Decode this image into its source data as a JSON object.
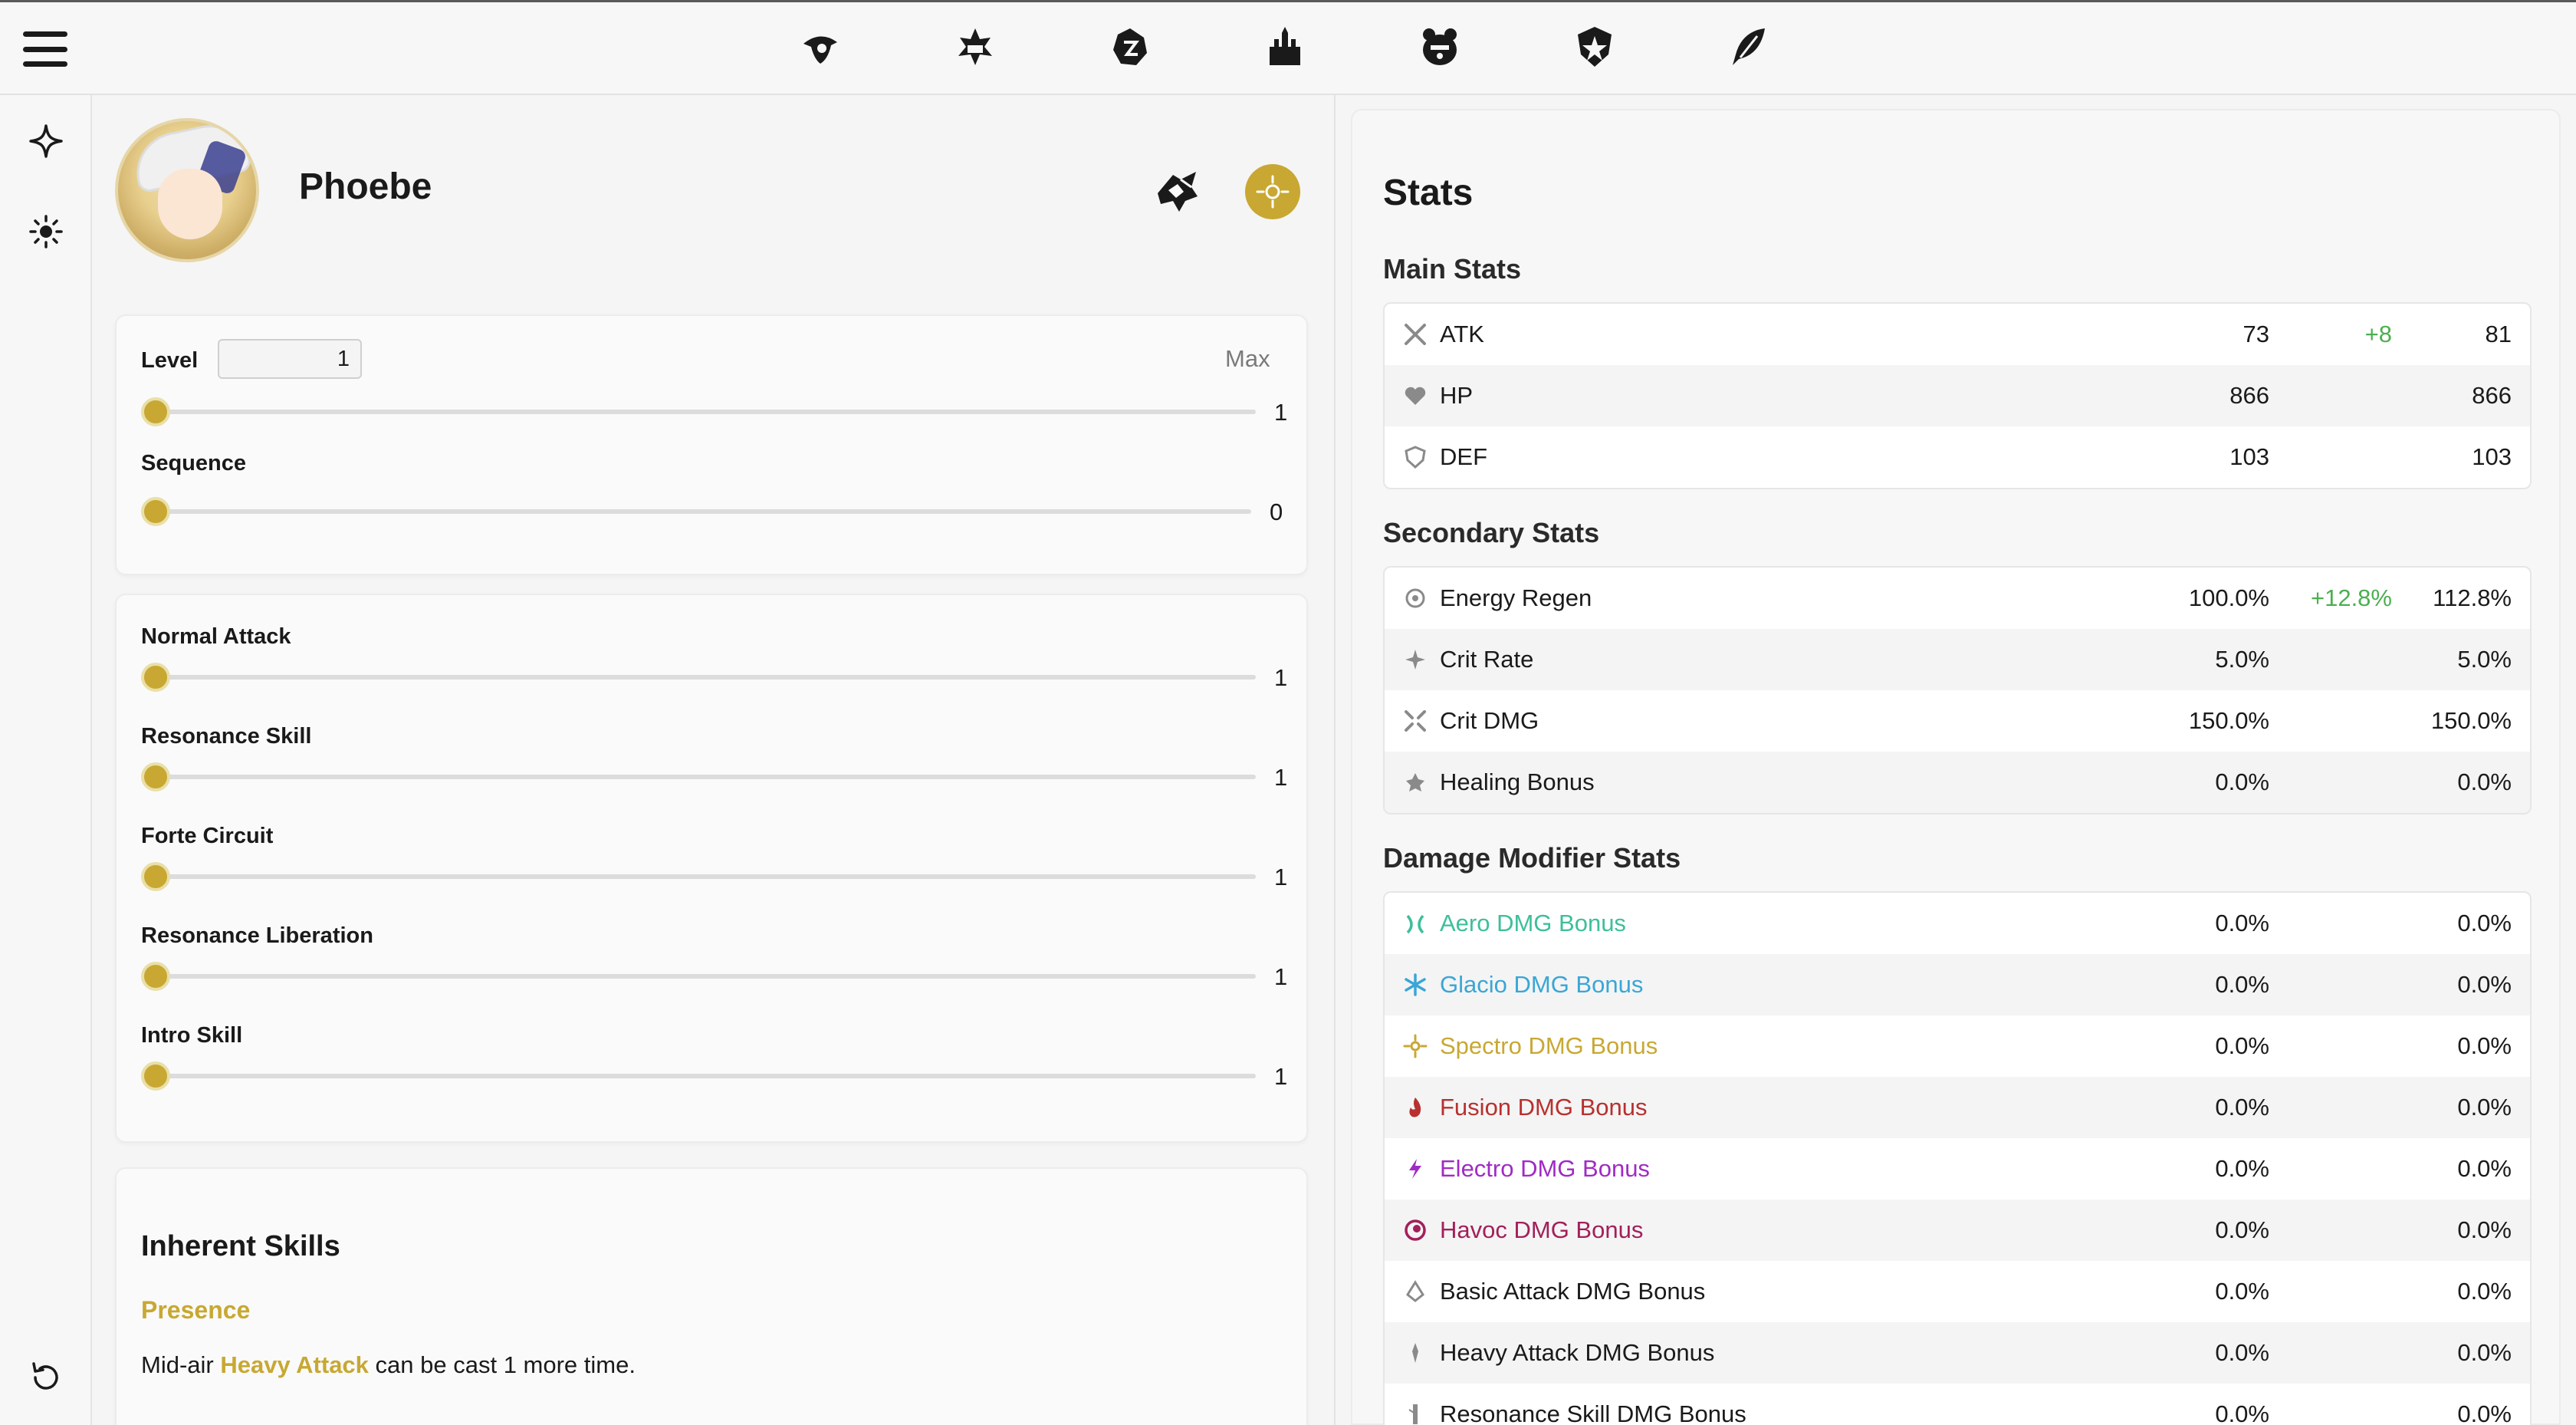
{
  "character": {
    "name": "Phoebe"
  },
  "progression": {
    "level_label": "Level",
    "level_value": "1",
    "max_label": "Max",
    "level_slider_value": "1",
    "sequence_label": "Sequence",
    "sequence_value": "0"
  },
  "skills": [
    {
      "label": "Normal Attack",
      "value": "1"
    },
    {
      "label": "Resonance Skill",
      "value": "1"
    },
    {
      "label": "Forte Circuit",
      "value": "1"
    },
    {
      "label": "Resonance Liberation",
      "value": "1"
    },
    {
      "label": "Intro Skill",
      "value": "1"
    }
  ],
  "inherent": {
    "title": "Inherent Skills",
    "skill_name": "Presence",
    "desc_prefix": "Mid-air ",
    "desc_highlight": "Heavy Attack",
    "desc_suffix": " can be cast 1 more time."
  },
  "stats": {
    "title": "Stats",
    "main_title": "Main Stats",
    "main": [
      {
        "name": "ATK",
        "base": "73",
        "bonus": "+8",
        "total": "81",
        "icon": "atk-icon"
      },
      {
        "name": "HP",
        "base": "866",
        "bonus": "",
        "total": "866",
        "icon": "hp-icon"
      },
      {
        "name": "DEF",
        "base": "103",
        "bonus": "",
        "total": "103",
        "icon": "def-icon"
      }
    ],
    "secondary_title": "Secondary Stats",
    "secondary": [
      {
        "name": "Energy Regen",
        "base": "100.0%",
        "bonus": "+12.8%",
        "total": "112.8%",
        "icon": "energy-regen-icon"
      },
      {
        "name": "Crit Rate",
        "base": "5.0%",
        "bonus": "",
        "total": "5.0%",
        "icon": "crit-rate-icon"
      },
      {
        "name": "Crit DMG",
        "base": "150.0%",
        "bonus": "",
        "total": "150.0%",
        "icon": "crit-dmg-icon"
      },
      {
        "name": "Healing Bonus",
        "base": "0.0%",
        "bonus": "",
        "total": "0.0%",
        "icon": "healing-icon"
      }
    ],
    "damage_title": "Damage Modifier Stats",
    "damage": [
      {
        "name": "Aero DMG Bonus",
        "base": "0.0%",
        "total": "0.0%",
        "color": "#3dbf9a",
        "icon": "aero-icon"
      },
      {
        "name": "Glacio DMG Bonus",
        "base": "0.0%",
        "total": "0.0%",
        "color": "#3aa6d6",
        "icon": "glacio-icon"
      },
      {
        "name": "Spectro DMG Bonus",
        "base": "0.0%",
        "total": "0.0%",
        "color": "#c8a832",
        "icon": "spectro-icon"
      },
      {
        "name": "Fusion DMG Bonus",
        "base": "0.0%",
        "total": "0.0%",
        "color": "#b8302f",
        "icon": "fusion-icon"
      },
      {
        "name": "Electro DMG Bonus",
        "base": "0.0%",
        "total": "0.0%",
        "color": "#a02bc4",
        "icon": "electro-icon"
      },
      {
        "name": "Havoc DMG Bonus",
        "base": "0.0%",
        "total": "0.0%",
        "color": "#a31f5a",
        "icon": "havoc-icon"
      },
      {
        "name": "Basic Attack DMG Bonus",
        "base": "0.0%",
        "total": "0.0%",
        "color": "#1a1a1a",
        "icon": "basic-attack-icon"
      },
      {
        "name": "Heavy Attack DMG Bonus",
        "base": "0.0%",
        "total": "0.0%",
        "color": "#1a1a1a",
        "icon": "heavy-attack-icon"
      },
      {
        "name": "Resonance Skill DMG Bonus",
        "base": "0.0%",
        "total": "0.0%",
        "color": "#1a1a1a",
        "icon": "resonance-skill-icon"
      }
    ]
  },
  "colors": {
    "accent": "#c8a832",
    "bonus_green": "#4caf50"
  }
}
